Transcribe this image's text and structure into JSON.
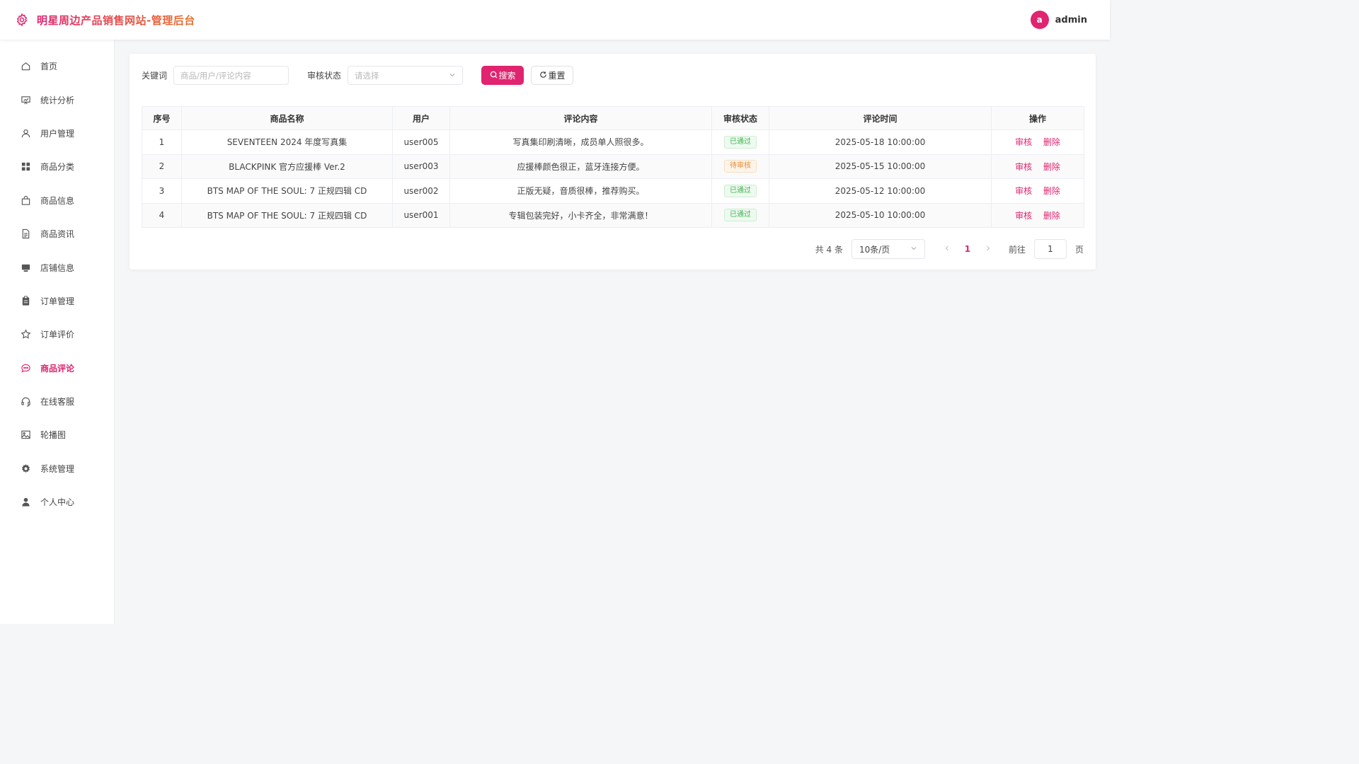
{
  "header": {
    "title": "明星周边产品销售网站-管理后台",
    "avatar_letter": "a",
    "username": "admin"
  },
  "sidebar": {
    "items": [
      {
        "label": "首页",
        "icon": "home-icon"
      },
      {
        "label": "统计分析",
        "icon": "chart-icon"
      },
      {
        "label": "用户管理",
        "icon": "user-icon"
      },
      {
        "label": "商品分类",
        "icon": "grid-icon"
      },
      {
        "label": "商品信息",
        "icon": "bag-icon"
      },
      {
        "label": "商品资讯",
        "icon": "document-icon"
      },
      {
        "label": "店铺信息",
        "icon": "shop-icon"
      },
      {
        "label": "订单管理",
        "icon": "clipboard-icon"
      },
      {
        "label": "订单评价",
        "icon": "star-icon"
      },
      {
        "label": "商品评论",
        "icon": "comment-icon",
        "active": true
      },
      {
        "label": "在线客服",
        "icon": "headset-icon"
      },
      {
        "label": "轮播图",
        "icon": "image-icon"
      },
      {
        "label": "系统管理",
        "icon": "gear-icon"
      },
      {
        "label": "个人中心",
        "icon": "person-icon"
      }
    ]
  },
  "filters": {
    "keyword_label": "关键词",
    "keyword_placeholder": "商品/用户/评论内容",
    "status_label": "审核状态",
    "status_placeholder": "请选择",
    "search_label": "搜索",
    "reset_label": "重置"
  },
  "table": {
    "columns": [
      "序号",
      "商品名称",
      "用户",
      "评论内容",
      "审核状态",
      "评论时间",
      "操作"
    ],
    "rows": [
      {
        "index": "1",
        "product": "SEVENTEEN 2024 年度写真集",
        "user": "user005",
        "content": "写真集印刷清晰，成员单人照很多。",
        "status": "已通过",
        "time": "2025-05-18 10:00:00"
      },
      {
        "index": "2",
        "product": "BLACKPINK 官方应援棒 Ver.2",
        "user": "user003",
        "content": "应援棒颜色很正，蓝牙连接方便。",
        "status": "待审核",
        "time": "2025-05-15 10:00:00"
      },
      {
        "index": "3",
        "product": "BTS MAP OF THE SOUL: 7 正规四辑 CD",
        "user": "user002",
        "content": "正版无疑，音质很棒，推荐购买。",
        "status": "已通过",
        "time": "2025-05-12 10:00:00"
      },
      {
        "index": "4",
        "product": "BTS MAP OF THE SOUL: 7 正规四辑 CD",
        "user": "user001",
        "content": "专辑包装完好，小卡齐全，非常满意！",
        "status": "已通过",
        "time": "2025-05-10 10:00:00"
      }
    ],
    "action_review": "审核",
    "action_delete": "删除"
  },
  "pagination": {
    "total": "共 4 条",
    "page_size": "10条/页",
    "current_page": "1",
    "goto_label": "前往",
    "goto_value": "1",
    "page_suffix": "页"
  },
  "colors": {
    "accent": "#e0246f",
    "approved": "#3eb650",
    "pending": "#e68a2e"
  }
}
